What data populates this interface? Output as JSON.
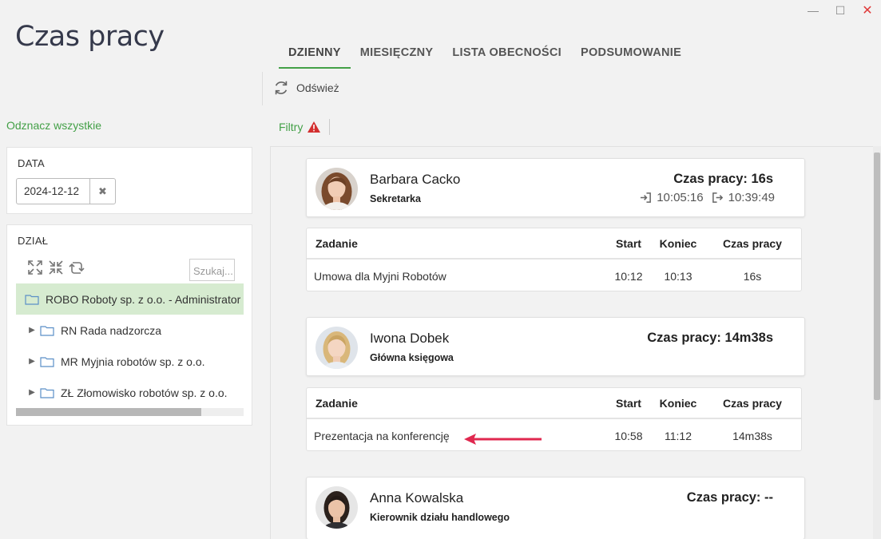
{
  "app": {
    "title": "Czas pracy"
  },
  "window": {
    "minimize": "—",
    "maximize": "☐",
    "close": "✕"
  },
  "tabs": [
    {
      "label": "DZIENNY",
      "active": true
    },
    {
      "label": "MIESIĘCZNY",
      "active": false
    },
    {
      "label": "LISTA OBECNOŚCI",
      "active": false
    },
    {
      "label": "PODSUMOWANIE",
      "active": false
    }
  ],
  "toolbar": {
    "refresh_label": "Odśwież"
  },
  "sidebar": {
    "mark_all": "Odznacz wszystkie",
    "date_label": "DATA",
    "date_value": "2024-12-12",
    "date_clear": "✖",
    "dept_label": "DZIAŁ",
    "search_placeholder": "Szukaj...",
    "departments": [
      {
        "label": "ROBO Roboty sp. z o.o. - Administrator",
        "selected": true
      },
      {
        "label": "RN Rada nadzorcza",
        "selected": false
      },
      {
        "label": "MR Myjnia robotów sp. z o.o.",
        "selected": false
      },
      {
        "label": "ZŁ Złomowisko robotów sp. z o.o.",
        "selected": false
      }
    ]
  },
  "filters": {
    "label": "Filtry"
  },
  "table_headers": {
    "task": "Zadanie",
    "start": "Start",
    "end": "Koniec",
    "duration": "Czas pracy"
  },
  "employees": [
    {
      "name": "Barbara Cacko",
      "role": "Sekretarka",
      "work_time": "Czas pracy: 16s",
      "clock_in": "10:05:16",
      "clock_out": "10:39:49",
      "tasks": [
        {
          "task": "Umowa dla Myjni Robotów",
          "start": "10:12",
          "end": "10:13",
          "duration": "16s"
        }
      ]
    },
    {
      "name": "Iwona Dobek",
      "role": "Główna księgowa",
      "work_time": "Czas pracy: 14m38s",
      "tasks": [
        {
          "task": "Prezentacja na konferencję",
          "start": "10:58",
          "end": "11:12",
          "duration": "14m38s"
        }
      ]
    },
    {
      "name": "Anna Kowalska",
      "role": "Kierownik działu handlowego",
      "work_time": "Czas pracy: --"
    }
  ],
  "colors": {
    "accent": "#43a047",
    "selected_row": "#d6ebd0",
    "arrow": "#e0284f",
    "warning": "#d32f2f"
  }
}
